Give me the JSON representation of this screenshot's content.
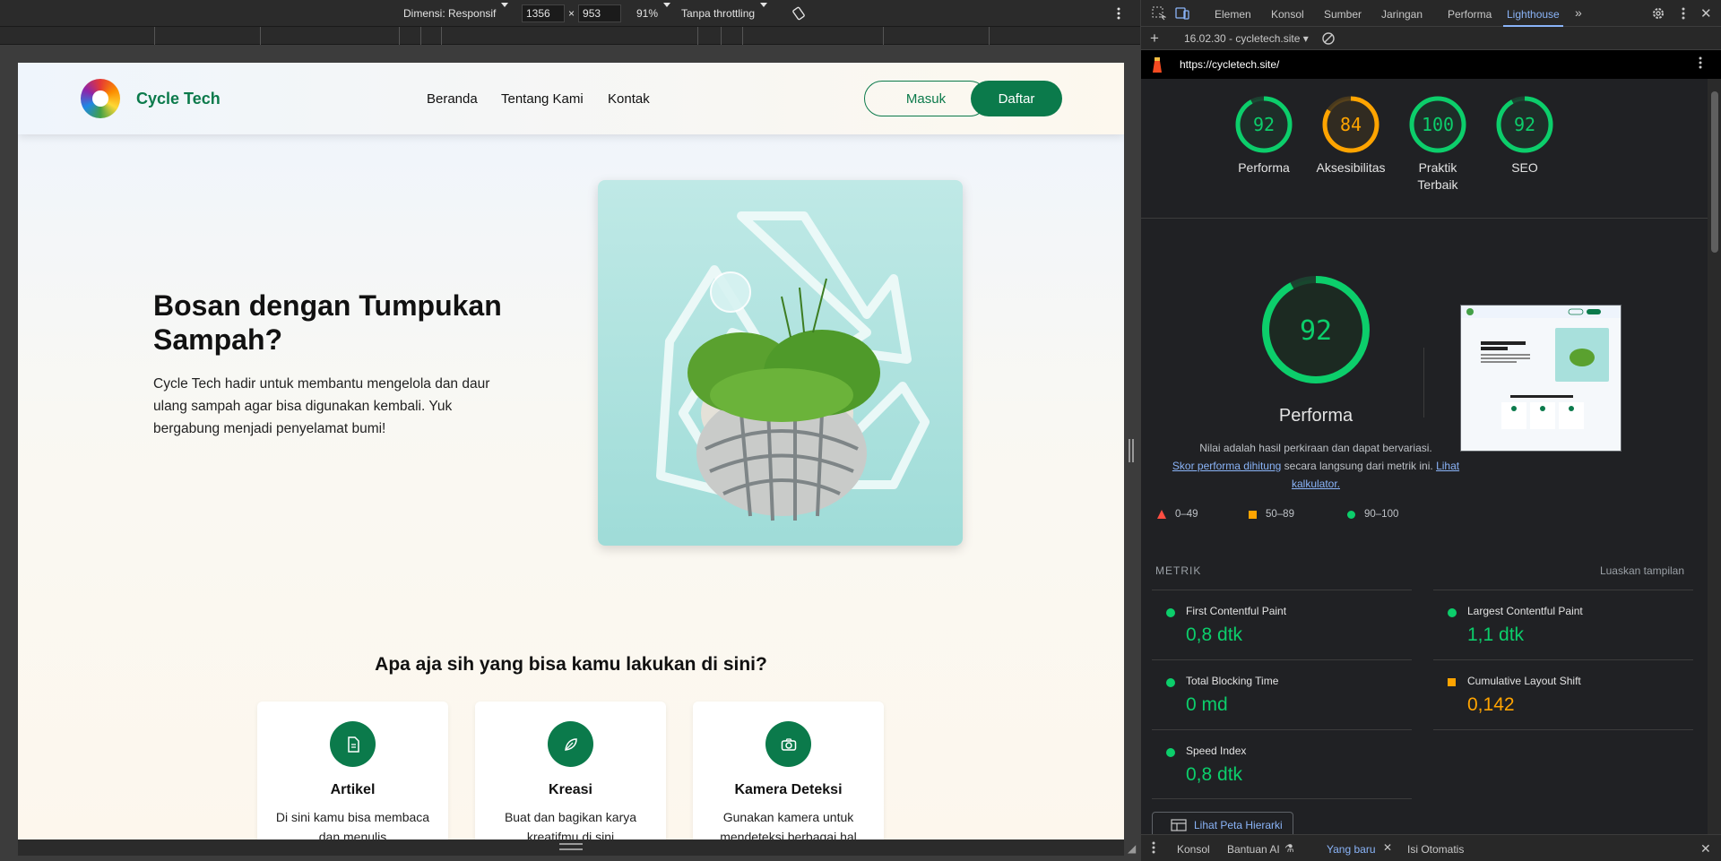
{
  "emulation": {
    "dimension_label": "Dimensi: Responsif",
    "width_value": "1356",
    "times": "×",
    "height_value": "953",
    "zoom": "91%",
    "throttling": "Tanpa throttling"
  },
  "site": {
    "brand": "Cycle Tech",
    "nav": [
      "Beranda",
      "Tentang Kami",
      "Kontak"
    ],
    "login": "Masuk",
    "register": "Daftar",
    "hero_title": "Bosan dengan Tumpukan Sampah?",
    "hero_desc": "Cycle Tech hadir untuk membantu mengelola dan daur ulang sampah agar bisa digunakan kembali. Yuk bergabung menjadi penyelamat bumi!",
    "section_title": "Apa aja sih yang bisa kamu lakukan di sini?",
    "cards": [
      {
        "title": "Artikel",
        "desc": "Di sini kamu bisa membaca dan menulis",
        "icon": "document-icon"
      },
      {
        "title": "Kreasi",
        "desc": "Buat dan bagikan karya kreatifmu di sini",
        "icon": "leaf-icon"
      },
      {
        "title": "Kamera Deteksi",
        "desc": "Gunakan kamera untuk mendeteksi berbagai hal",
        "icon": "camera-icon"
      }
    ]
  },
  "devtools": {
    "tabs": [
      "Elemen",
      "Konsol",
      "Sumber",
      "Jaringan",
      "Performa",
      "Lighthouse"
    ],
    "active_tab": "Lighthouse",
    "report_time": "16.02.30 - cycletech.site",
    "url": "https://cycletech.site/",
    "scores": [
      {
        "label": "Performa",
        "value": 92,
        "color": "#0cce6b"
      },
      {
        "label": "Aksesibilitas",
        "value": 84,
        "color": "#ffa400"
      },
      {
        "label": "Praktik Terbaik",
        "value": 100,
        "color": "#0cce6b"
      },
      {
        "label": "SEO",
        "value": 92,
        "color": "#0cce6b"
      }
    ],
    "main_score": 92,
    "main_label": "Performa",
    "note_text": "Nilai adalah hasil perkiraan dan dapat bervariasi.",
    "note_link1": "Skor performa dihitung",
    "note_mid": " secara langsung dari metrik ini. ",
    "note_link2": "Lihat kalkulator.",
    "legend": [
      "0–49",
      "50–89",
      "90–100"
    ],
    "metrik_heading": "METRIK",
    "expand_label": "Luaskan tampilan",
    "metrics": [
      {
        "name": "First Contentful Paint",
        "value": "0,8 dtk",
        "status": "good"
      },
      {
        "name": "Largest Contentful Paint",
        "value": "1,1 dtk",
        "status": "good"
      },
      {
        "name": "Total Blocking Time",
        "value": "0 md",
        "status": "good"
      },
      {
        "name": "Cumulative Layout Shift",
        "value": "0,142",
        "status": "average"
      },
      {
        "name": "Speed Index",
        "value": "0,8 dtk",
        "status": "good"
      }
    ],
    "treemap_button": "Lihat Peta Hierarki",
    "drawer_tabs": [
      "Konsol",
      "Bantuan AI",
      "Yang baru",
      "Isi Otomatis"
    ],
    "active_drawer_tab": "Yang baru",
    "colors": {
      "good": "#0cce6b",
      "average": "#ffa400",
      "poor": "#ff4e42"
    }
  }
}
